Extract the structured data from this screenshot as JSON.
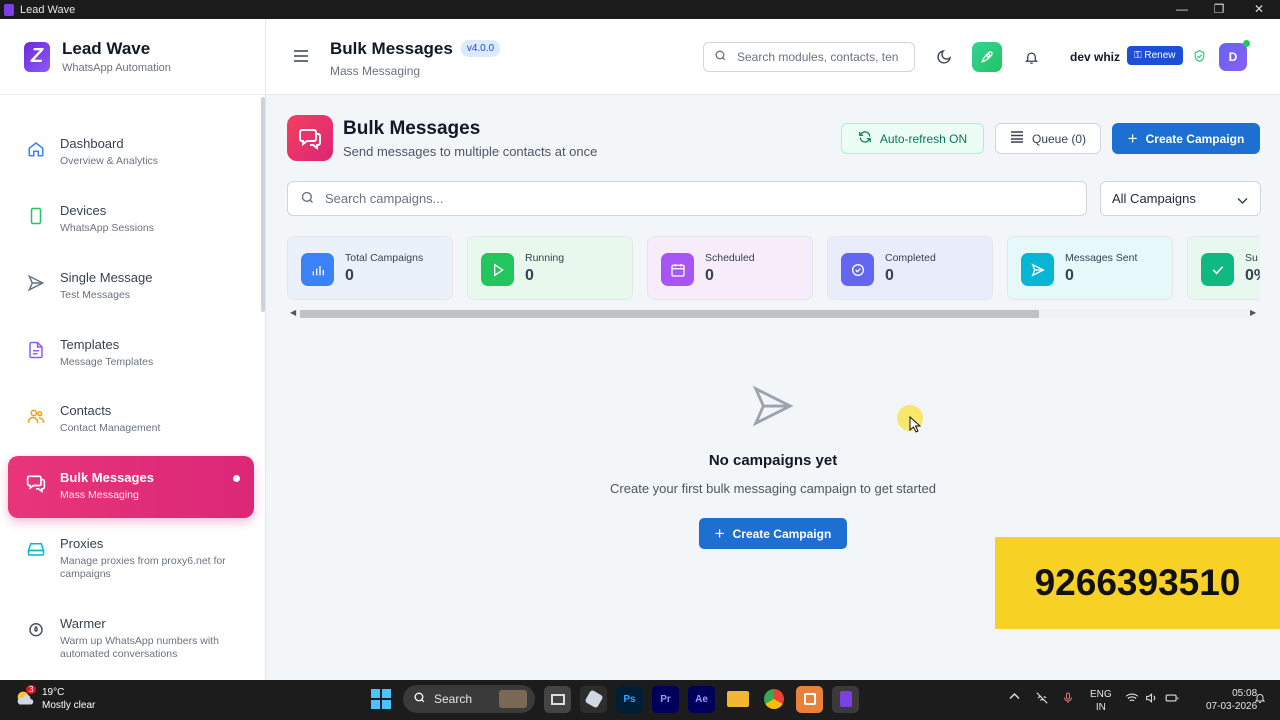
{
  "window": {
    "title": "Lead Wave",
    "controls": [
      "—",
      "❐",
      "✕"
    ]
  },
  "brand": {
    "name": "Lead Wave",
    "tagline": "WhatsApp Automation",
    "logo_letter": "Z"
  },
  "sidebar": {
    "items": [
      {
        "label": "Dashboard",
        "sub": "Overview & Analytics",
        "icon": "home-icon",
        "color": "#3b82f6"
      },
      {
        "label": "Devices",
        "sub": "WhatsApp Sessions",
        "icon": "phone-icon",
        "color": "#22c55e"
      },
      {
        "label": "Single Message",
        "sub": "Test Messages",
        "icon": "send-icon",
        "color": "#64748b"
      },
      {
        "label": "Templates",
        "sub": "Message Templates",
        "icon": "document-icon",
        "color": "#8b5cf6"
      },
      {
        "label": "Contacts",
        "sub": "Contact Management",
        "icon": "users-icon",
        "color": "#f59e0b"
      },
      {
        "label": "Bulk Messages",
        "sub": "Mass Messaging",
        "icon": "chat-icon",
        "color": "#ffffff",
        "active": true
      },
      {
        "label": "Proxies",
        "sub": "Manage proxies from proxy6.net for campaigns",
        "icon": "server-icon",
        "color": "#06b6d4"
      },
      {
        "label": "Warmer",
        "sub": "Warm up WhatsApp numbers with automated conversations",
        "icon": "flame-icon",
        "color": "#6b7280"
      }
    ]
  },
  "topbar": {
    "title": "Bulk Messages",
    "version": "v4.0.0",
    "subtitle": "Mass Messaging",
    "search_placeholder": "Search modules, contacts, ten",
    "user_name": "dev whiz",
    "renew_label": "Renew",
    "avatar_letter": "D"
  },
  "page": {
    "title": "Bulk Messages",
    "subtitle": "Send messages to multiple contacts at once",
    "auto_refresh_label": "Auto-refresh ON",
    "queue_label": "Queue (0)",
    "create_label": "Create Campaign",
    "search_placeholder": "Search campaigns...",
    "filter_value": "All Campaigns"
  },
  "stats": [
    {
      "label": "Total Campaigns",
      "value": "0",
      "bg": "#eaf1fb",
      "icon_bg": "#3b82f6",
      "icon": "bar-chart-icon"
    },
    {
      "label": "Running",
      "value": "0",
      "bg": "#e8f8ec",
      "icon_bg": "#22c55e",
      "icon": "play-icon"
    },
    {
      "label": "Scheduled",
      "value": "0",
      "bg": "#f6ecfa",
      "icon_bg": "#a855f7",
      "icon": "calendar-icon"
    },
    {
      "label": "Completed",
      "value": "0",
      "bg": "#e9ecfb",
      "icon_bg": "#6366f1",
      "icon": "check-circle-icon"
    },
    {
      "label": "Messages Sent",
      "value": "0",
      "bg": "#e6f8fa",
      "icon_bg": "#06b6d4",
      "icon": "send-icon"
    },
    {
      "label": "Su",
      "value": "0%",
      "bg": "#e8f8ee",
      "icon_bg": "#10b981",
      "icon": "check-icon"
    }
  ],
  "empty": {
    "title": "No campaigns yet",
    "subtitle": "Create your first bulk messaging campaign to get started",
    "button_label": "Create Campaign"
  },
  "overlay": {
    "phone": "9266393510"
  },
  "taskbar": {
    "temperature": "19°C",
    "weather": "Mostly clear",
    "weather_badge": "3",
    "search_label": "Search",
    "lang_line1": "ENG",
    "lang_line2": "IN",
    "time": "05:08",
    "date": "07-03-2026",
    "apps": [
      {
        "name": "file-manager-app-icon",
        "label": "",
        "bg": "#444"
      },
      {
        "name": "obs-app-icon",
        "label": "",
        "bg": "#2d2d2d"
      },
      {
        "name": "photoshop-app-icon",
        "label": "Ps",
        "bg": "#001e36",
        "fg": "#31a8ff"
      },
      {
        "name": "premiere-app-icon",
        "label": "Pr",
        "bg": "#00005b",
        "fg": "#9999ff"
      },
      {
        "name": "after-effects-app-icon",
        "label": "Ae",
        "bg": "#00005b",
        "fg": "#9999ff"
      },
      {
        "name": "folder-app-icon",
        "label": "",
        "bg": "#f2b731"
      },
      {
        "name": "chrome-app-icon",
        "label": "",
        "bg": "#2d2d2d"
      },
      {
        "name": "recorder-app-icon",
        "label": "",
        "bg": "#e8823a"
      },
      {
        "name": "lead-wave-app-icon",
        "label": "",
        "bg": "#6d28d9"
      }
    ]
  }
}
